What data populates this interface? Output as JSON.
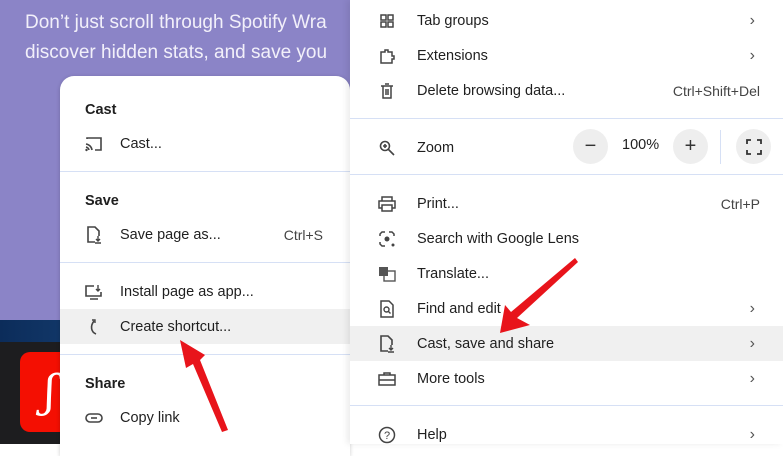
{
  "background": {
    "text_line1": "Don’t just scroll through Spotify Wra",
    "text_line2": "discover hidden stats, and save you"
  },
  "submenu": {
    "sections": {
      "cast_header": "Cast",
      "cast_item": "Cast...",
      "save_header": "Save",
      "save_page": "Save page as...",
      "save_page_shortcut": "Ctrl+S",
      "install_app": "Install page as app...",
      "create_shortcut": "Create shortcut...",
      "share_header": "Share",
      "copy_link": "Copy link"
    }
  },
  "menu": {
    "tab_groups": "Tab groups",
    "extensions": "Extensions",
    "delete_browsing": "Delete browsing data...",
    "delete_shortcut": "Ctrl+Shift+Del",
    "zoom": "Zoom",
    "zoom_minus": "−",
    "zoom_level": "100%",
    "zoom_plus": "+",
    "print": "Print...",
    "print_shortcut": "Ctrl+P",
    "lens": "Search with Google Lens",
    "translate": "Translate...",
    "find_edit": "Find and edit",
    "cast_save_share": "Cast, save and share",
    "more_tools": "More tools",
    "help": "Help"
  },
  "colors": {
    "arrow": "#e8141b",
    "highlight": "#f0f0f0",
    "background_purple": "#8b84c7"
  }
}
